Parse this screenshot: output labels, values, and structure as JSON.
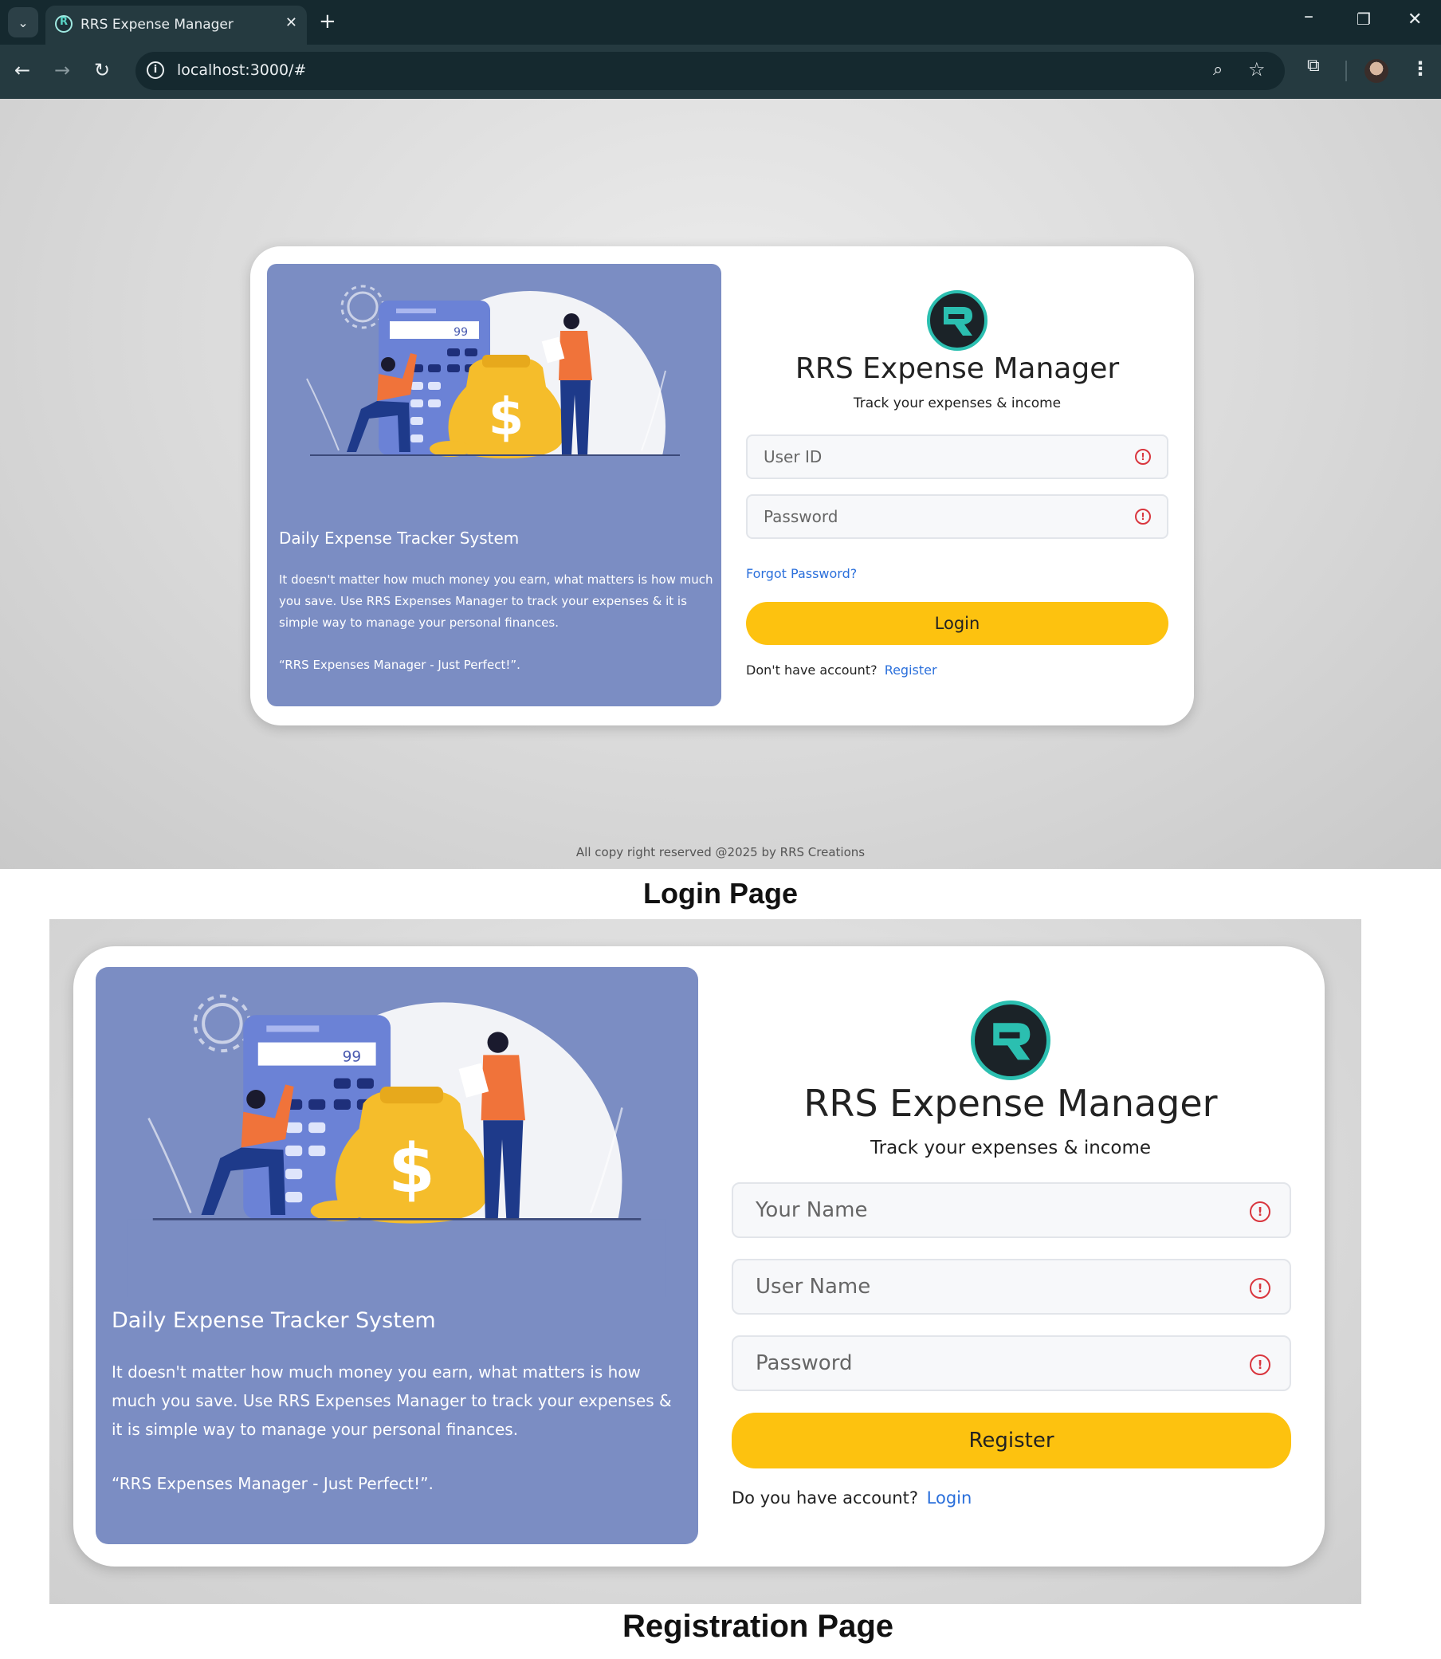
{
  "browser": {
    "tab_title": "RRS Expense Manager",
    "tab_close": "✕",
    "new_tab": "+",
    "url": "localhost:3000/#",
    "icons": [
      "tab-list-icon",
      "favicon-icon",
      "back-icon",
      "forward-icon",
      "reload-icon",
      "site-info-icon",
      "zoom-icon",
      "bookmark-star-icon",
      "extensions-icon",
      "profile-avatar",
      "menu-icon",
      "minimize-icon",
      "restore-icon",
      "close-window-icon"
    ]
  },
  "hero": {
    "illustration_display": "99",
    "title": "Daily Expense Tracker System",
    "text": "It doesn't matter how much money you earn, what matters is how much you save. Use RRS Expenses Manager to track your expenses & it is simple way to manage your personal finances.",
    "quote": "“RRS Expenses Manager - Just Perfect!”."
  },
  "login": {
    "brand": "RRS Expense Manager",
    "tagline": "Track your expenses & income",
    "user_placeholder": "User ID",
    "password_placeholder": "Password",
    "forgot": "Forgot Password?",
    "button": "Login",
    "footer_prompt": "Don't have account?",
    "footer_link": "Register"
  },
  "register": {
    "brand": "RRS Expense Manager",
    "tagline": "Track your expenses & income",
    "name_placeholder": "Your Name",
    "username_placeholder": "User Name",
    "password_placeholder": "Password",
    "button": "Register",
    "footer_prompt": "Do you have account?",
    "footer_link": "Login"
  },
  "footer": "All copy right reserved @2025 by RRS Creations",
  "captions": {
    "login": "Login Page",
    "register": "Registration Page"
  },
  "colors": {
    "accent": "#fdc20f",
    "hero_bg": "#7b8dc3",
    "link": "#2a6fdb",
    "error": "#d9363e",
    "logo_ring": "#2bbfb0"
  }
}
